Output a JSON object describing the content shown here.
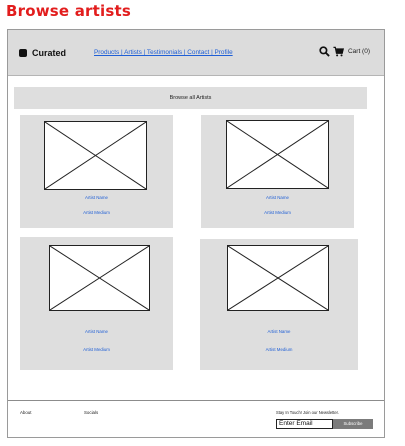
{
  "page": {
    "title": "Browse artists",
    "accent": "#e21d1d"
  },
  "header": {
    "logo": "Curated",
    "nav": "Products | Artists | Testimonials | Contact | Profile",
    "cart": "Cart (0)",
    "icons": [
      "search-icon",
      "cart-icon"
    ],
    "link_color": "#1f5fd6"
  },
  "main": {
    "heading": "Browse all Artists",
    "cards": [
      {
        "name": "Artist Name",
        "medium": "Artist Medium"
      },
      {
        "name": "Artist Name",
        "medium": "Artist Medium"
      },
      {
        "name": "Artist Name",
        "medium": "Artist Medium"
      },
      {
        "name": "Artist Name",
        "medium": "Artist Medium"
      }
    ]
  },
  "footer": {
    "about": "About",
    "socials": "Socials",
    "newsletter": "Stay In Touch! Join our Newsletter.",
    "email_value": "Enter Email",
    "subscribe": "Subscribe"
  }
}
